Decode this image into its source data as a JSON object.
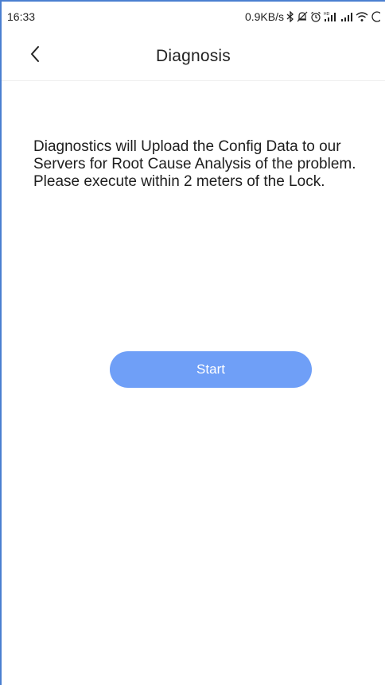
{
  "status_bar": {
    "time": "16:33",
    "network_speed": "0.9KB/s",
    "icons": [
      "bluetooth-icon",
      "mute-icon",
      "alarm-icon",
      "hd-signal-icon",
      "signal-icon",
      "wifi-icon",
      "battery-icon"
    ]
  },
  "header": {
    "title": "Diagnosis",
    "back_icon": "chevron-left-icon"
  },
  "main": {
    "message_lines": [
      "Diagnostics will Upload the Config Data to our",
      "Servers for Root Cause Analysis of the problem.",
      "Please execute within 2 meters of the Lock."
    ],
    "start_label": "Start"
  },
  "colors": {
    "accent": "#6f9ff7",
    "frame_border": "#4a7fd0"
  }
}
